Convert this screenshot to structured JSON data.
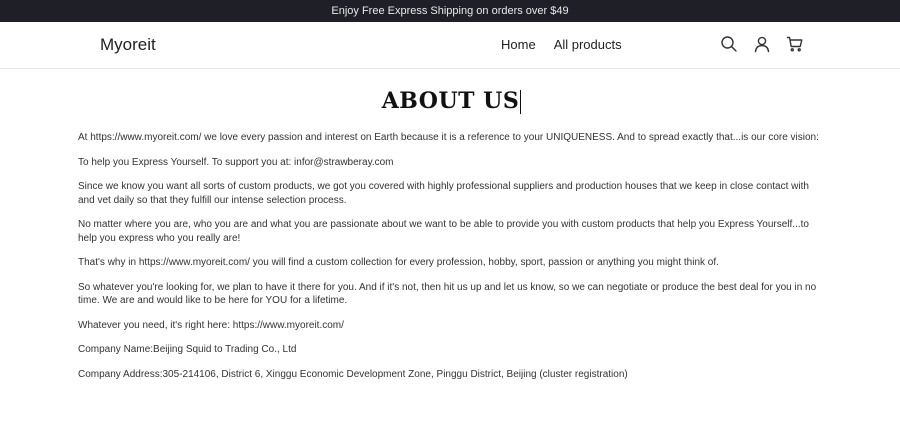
{
  "announcement": {
    "text": "Enjoy Free Express Shipping on orders over $49"
  },
  "header": {
    "logo": "Myoreit",
    "nav": [
      {
        "label": "Home"
      },
      {
        "label": "All products"
      }
    ],
    "icons": [
      "search-icon",
      "account-icon",
      "cart-icon"
    ]
  },
  "page": {
    "title": "ABOUT US",
    "paragraphs": [
      "At https://www.myoreit.com/ we love every passion and interest on Earth because it is a reference to your UNIQUENESS. And to spread exactly that...is our core vision:",
      "To help you Express Yourself. To support you at: infor@strawberay.com",
      "Since we know you want all sorts of custom products, we got you covered with highly professional suppliers and production houses that we keep in close contact with and vet daily so that they fulfill our intense selection process.",
      "No matter where you are, who you are and what you are passionate about we want to be able to provide you with custom products that help you Express Yourself...to help you express who you really are!",
      "That's why in https://www.myoreit.com/ you will find a custom collection for every profession, hobby, sport, passion or anything you might think of.",
      "So whatever you're looking for, we plan to have it there for you. And if it's not, then hit us up and let us know, so we can negotiate or produce the best deal for you in no time. We are and would like to be here for YOU for a lifetime.",
      "Whatever you need, it's right here: https://www.myoreit.com/",
      "Company Name:Beijing Squid to Trading Co., Ltd",
      "Company Address:305-214106, District 6, Xinggu Economic Development Zone, Pinggu District, Beijing (cluster registration)"
    ]
  },
  "colors": {
    "announcement_bg": "#1f2027",
    "announcement_text": "#e9e9e9",
    "body_text": "#333333",
    "title_text": "#111111"
  }
}
